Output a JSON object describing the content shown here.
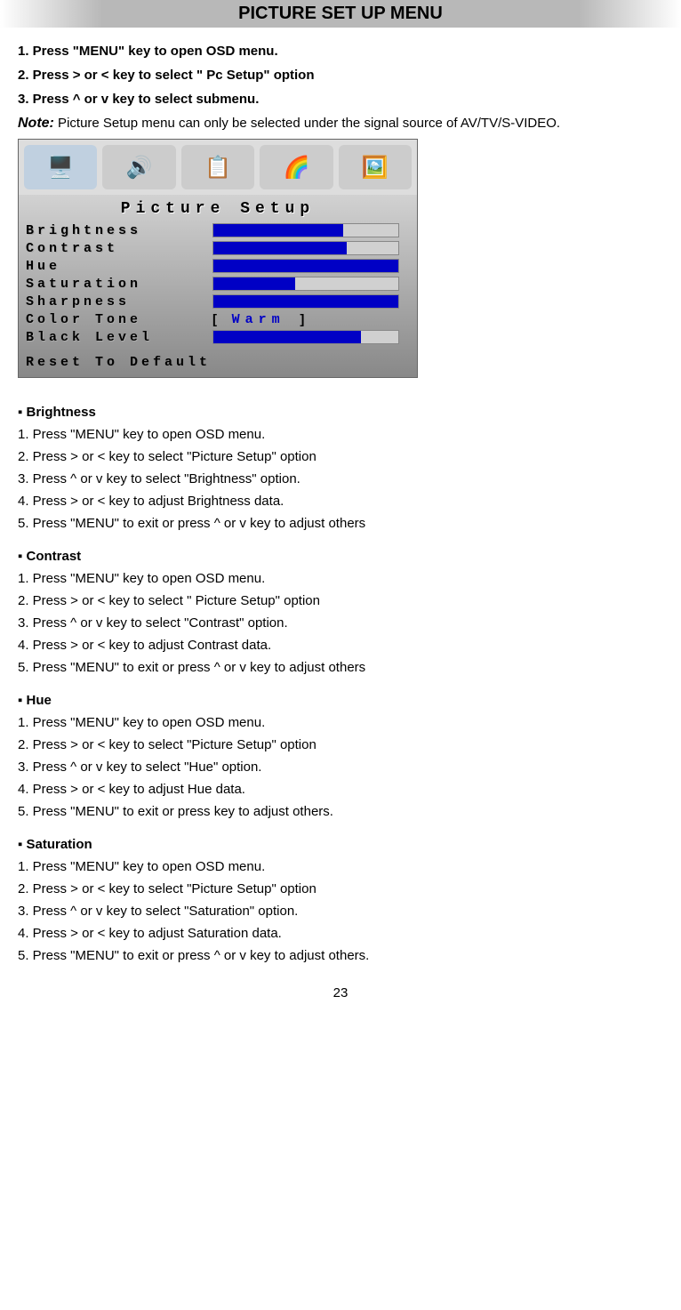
{
  "title": "PICTURE SET UP MENU",
  "intro": [
    "1. Press \"MENU\" key to open OSD menu.",
    "2. Press > or < key to select \" Pc Setup\" option",
    "3. Press ^ or v key to select submenu."
  ],
  "note": {
    "label": "Note:",
    "text": " Picture Setup menu can only be selected under the signal source of AV/TV/S-VIDEO."
  },
  "osd": {
    "title": "Picture Setup",
    "rows": [
      {
        "label": "Brightness",
        "fill": 70
      },
      {
        "label": "Contrast",
        "fill": 72
      },
      {
        "label": "Hue",
        "fill": 100
      },
      {
        "label": "Saturation",
        "fill": 44
      },
      {
        "label": "Sharpness",
        "fill": 100
      },
      {
        "label": "Color Tone",
        "text": "Warm"
      },
      {
        "label": "Black Level",
        "fill": 80
      }
    ],
    "reset": "Reset To Default"
  },
  "sections": [
    {
      "heading": "▪ Brightness",
      "steps": [
        "1. Press \"MENU\" key to open OSD menu.",
        "2. Press > or < key to select \"Picture Setup\" option",
        "3. Press ^ or v key to select \"Brightness\" option.",
        "4. Press > or < key to adjust Brightness data.",
        "5. Press \"MENU\" to exit or press ^ or v key to adjust others"
      ]
    },
    {
      "heading": "▪ Contrast",
      "steps": [
        "1. Press \"MENU\" key to open OSD menu.",
        "2. Press > or < key to select \" Picture Setup\" option",
        "3. Press ^ or v key to select \"Contrast\" option.",
        "4. Press > or < key to adjust Contrast data.",
        "5. Press \"MENU\" to exit or press ^ or v key to adjust others"
      ]
    },
    {
      "heading": "▪ Hue",
      "steps": [
        "1. Press \"MENU\" key to open OSD menu.",
        "2. Press > or < key to select \"Picture Setup\" option",
        "3. Press ^ or v key to select \"Hue\" option.",
        "4. Press > or < key to adjust Hue data.",
        "5. Press \"MENU\" to exit or press key to adjust others."
      ]
    },
    {
      "heading": "▪ Saturation",
      "steps": [
        "1. Press \"MENU\" key to open OSD menu.",
        "2. Press > or < key to select \"Picture Setup\" option",
        "3. Press ^ or v key to select \"Saturation\" option.",
        "4. Press > or < key to adjust Saturation data.",
        "5. Press \"MENU\" to exit or press ^ or v key to adjust others."
      ]
    }
  ],
  "pageNumber": "23"
}
